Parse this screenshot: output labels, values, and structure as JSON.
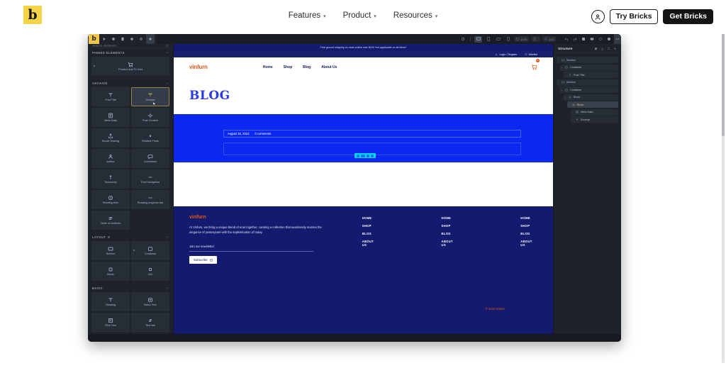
{
  "site_nav": {
    "brand": "b",
    "items": [
      {
        "label": "Features",
        "caret": "chevron-down"
      },
      {
        "label": "Product",
        "caret": "chevron-down"
      },
      {
        "label": "Resources",
        "caret": "chevron-down"
      }
    ],
    "account_icon": "account-circle-icon",
    "try_label": "Try Bricks",
    "get_label": "Get Bricks"
  },
  "editor": {
    "toolbar": {
      "logo": "b",
      "left_icons": [
        "play-icon",
        "settings-icon",
        "page-icon",
        "globe-icon",
        "gear-icon",
        "plus-icon"
      ],
      "right_icons": [
        "undo-icon",
        "redo-icon",
        "save-icon",
        "layers-icon",
        "eye-icon",
        "help-icon",
        "more-icon"
      ],
      "breakpoints": [
        {
          "name": "desktop-breakpoint",
          "active": true
        },
        {
          "name": "tablet-portrait-breakpoint",
          "active": false
        },
        {
          "name": "mobile-landscape-breakpoint",
          "active": false
        },
        {
          "name": "mobile-portrait-breakpoint",
          "active": false
        }
      ],
      "width_value": "1045",
      "zoom_value": "100"
    },
    "left_panel": {
      "search_placeholder": "Search elements ...",
      "sections": [
        {
          "title": "PINNED ELEMENTS",
          "collapse": "chevron-down",
          "columns": 1,
          "items": [
            {
              "label": "Product Add To Cart",
              "icon": "cart-icon",
              "pinned": true,
              "selected": false
            }
          ]
        },
        {
          "title": "ARCHIVE",
          "collapse": "chevron-down",
          "columns": 2,
          "items": [
            {
              "label": "Post Title",
              "icon": "text-title-icon",
              "selected": false
            },
            {
              "label": "Excerpt",
              "icon": "excerpt-icon",
              "selected": true
            },
            {
              "label": "Meta Data",
              "icon": "meta-data-icon",
              "selected": false
            },
            {
              "label": "Post Content",
              "icon": "post-content-icon",
              "selected": false
            },
            {
              "label": "Social Sharing",
              "icon": "share-icon",
              "selected": false
            },
            {
              "label": "Related Posts",
              "icon": "related-posts-icon",
              "selected": false
            },
            {
              "label": "Author",
              "icon": "user-icon",
              "selected": false
            },
            {
              "label": "Comments",
              "icon": "comment-icon",
              "selected": false
            },
            {
              "label": "Taxonomy",
              "icon": "tag-icon",
              "selected": false
            },
            {
              "label": "Post Navigation",
              "icon": "navigation-icon",
              "selected": false
            },
            {
              "label": "Reading time",
              "icon": "clock-icon",
              "selected": false
            },
            {
              "label": "Reading progress bar",
              "icon": "progress-bar-icon",
              "selected": false
            },
            {
              "label": "Table of contents",
              "icon": "list-icon",
              "selected": false
            }
          ]
        },
        {
          "title": "LAYOUT",
          "collapse": "chevron-down",
          "columns": 2,
          "items": [
            {
              "label": "Section",
              "icon": "section-icon",
              "selected": false
            },
            {
              "label": "Container",
              "icon": "container-icon",
              "pinned": true,
              "selected": false
            },
            {
              "label": "Block",
              "icon": "block-icon",
              "selected": false
            },
            {
              "label": "Div",
              "icon": "div-icon",
              "selected": false
            }
          ]
        },
        {
          "title": "BASIC",
          "collapse": "chevron-down",
          "columns": 2,
          "items": [
            {
              "label": "Heading",
              "icon": "heading-icon",
              "selected": false
            },
            {
              "label": "Basic Text",
              "icon": "basic-text-icon",
              "selected": false
            },
            {
              "label": "Rich Text",
              "icon": "rich-text-icon",
              "selected": false
            },
            {
              "label": "Text link",
              "icon": "link-icon",
              "selected": false
            }
          ]
        }
      ]
    },
    "right_panel": {
      "title": "Structure",
      "icons": [
        "delete-icon",
        "import-icon",
        "collapse-icon",
        "add-icon"
      ],
      "tree": [
        {
          "label": "Section",
          "icon": "section-icon",
          "depth": 0,
          "selected": false,
          "arrow": "chevron-down"
        },
        {
          "label": "Container",
          "icon": "container-icon",
          "depth": 1,
          "selected": false,
          "arrow": "chevron-down"
        },
        {
          "label": "Post Title",
          "icon": "text-title-icon",
          "depth": 2,
          "selected": false,
          "arrow": ""
        },
        {
          "label": "Section",
          "icon": "section-icon",
          "depth": 0,
          "selected": false,
          "arrow": "chevron-down"
        },
        {
          "label": "Container",
          "icon": "container-icon",
          "depth": 1,
          "selected": false,
          "arrow": "chevron-down"
        },
        {
          "label": "Block",
          "icon": "block-icon",
          "depth": 2,
          "selected": false,
          "arrow": "chevron-down"
        },
        {
          "label": "Block",
          "icon": "block-icon",
          "depth": 3,
          "selected": true,
          "arrow": "chevron-down"
        },
        {
          "label": "Meta Data",
          "icon": "meta-data-icon",
          "depth": 4,
          "selected": false,
          "arrow": ""
        },
        {
          "label": "Excerpt",
          "icon": "excerpt-icon",
          "depth": 4,
          "selected": false,
          "arrow": ""
        }
      ]
    },
    "canvas": {
      "announcement": "Free ground shipping on most orders over $100 *not applicable on all items*",
      "utility": [
        {
          "label": "Login / Register",
          "icon": "user-icon"
        },
        {
          "label": "Wishlist",
          "icon": "heart-icon"
        }
      ],
      "logo": "vinfurn",
      "menu": [
        "Home",
        "Shop",
        "Blog",
        "About Us"
      ],
      "cart_icon": "cart-icon",
      "cart_count": "0",
      "page_title": "BLOG",
      "post_meta": {
        "date": "August 15, 2023",
        "comments": "0 comments"
      },
      "element_toolbar_icons": [
        "move-icon",
        "duplicate-icon",
        "settings-icon",
        "delete-icon"
      ],
      "footer": {
        "logo": "vinfurn",
        "description": "At Vinfurn, we bring a unique blend of eras together, curating a collection that seamlessly marries the elegance of yesteryears with the sophistication of today.",
        "newsletter_label": "Join our newsletter",
        "subscribe_label": "Subscribe",
        "subscribe_icon": "mail-icon",
        "columns": [
          {
            "links": [
              "HOME",
              "SHOP",
              "BLOG",
              "ABOUT US"
            ]
          },
          {
            "links": [
              "HOME",
              "SHOP",
              "BLOG",
              "ABOUT US"
            ]
          },
          {
            "links": [
              "HOME",
              "SHOP",
              "BLOG",
              "ABOUT US"
            ]
          }
        ],
        "copyright": "© 2023 vinfurn"
      }
    }
  },
  "colors": {
    "brand_yellow": "#f5d547",
    "editor_bg": "#1e222a",
    "navy": "#141a6e",
    "blue_band": "#0a28f0",
    "orange": "#e05a1e",
    "cyan": "#00d9ff",
    "gold": "#e8c560"
  }
}
